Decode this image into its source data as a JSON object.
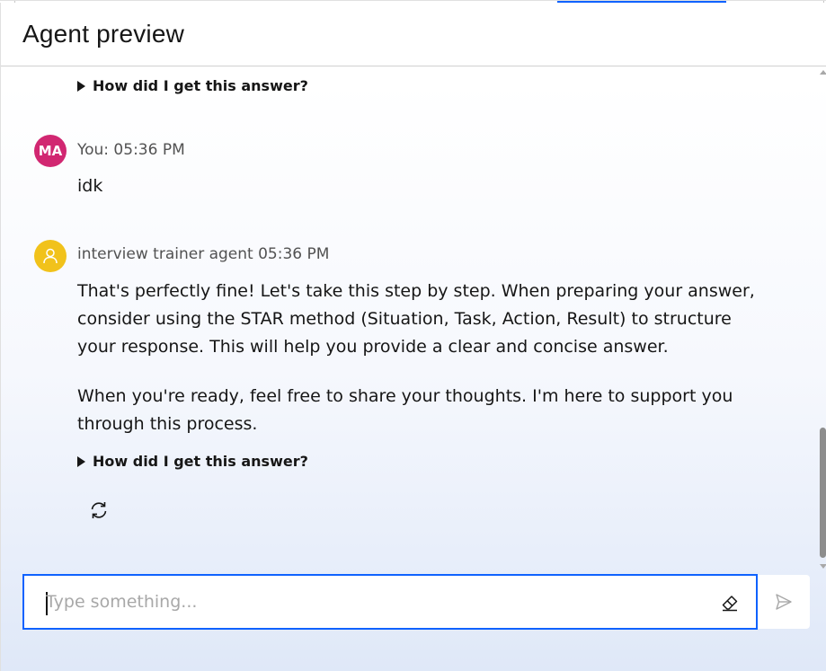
{
  "header": {
    "title": "Agent preview"
  },
  "messages": {
    "first_expander_label": "How did I get this answer?",
    "user": {
      "initials": "MA",
      "meta": "You: 05:36 PM",
      "text": "idk"
    },
    "agent": {
      "meta": "interview trainer agent 05:36 PM",
      "paragraph1_line1": "That's perfectly fine! Let's take this step by step. When preparing your answer,",
      "paragraph1_line2": "consider using the STAR method (Situation, Task, Action, Result) to structure",
      "paragraph1_line3": "your response. This will help you provide a clear and concise answer.",
      "paragraph2_line1": "When you're ready, feel free to share your thoughts. I'm here to support you",
      "paragraph2_line2": "through this process.",
      "expander_label": "How did I get this answer?"
    }
  },
  "input": {
    "placeholder": "Type something...",
    "value": ""
  },
  "icons": {
    "agent_avatar": "user-outline-icon",
    "regenerate": "refresh-icon",
    "clear": "eraser-icon",
    "send": "send-icon"
  },
  "colors": {
    "accent": "#0f62fe",
    "user_avatar": "#d12771",
    "agent_avatar": "#f1c21b"
  }
}
